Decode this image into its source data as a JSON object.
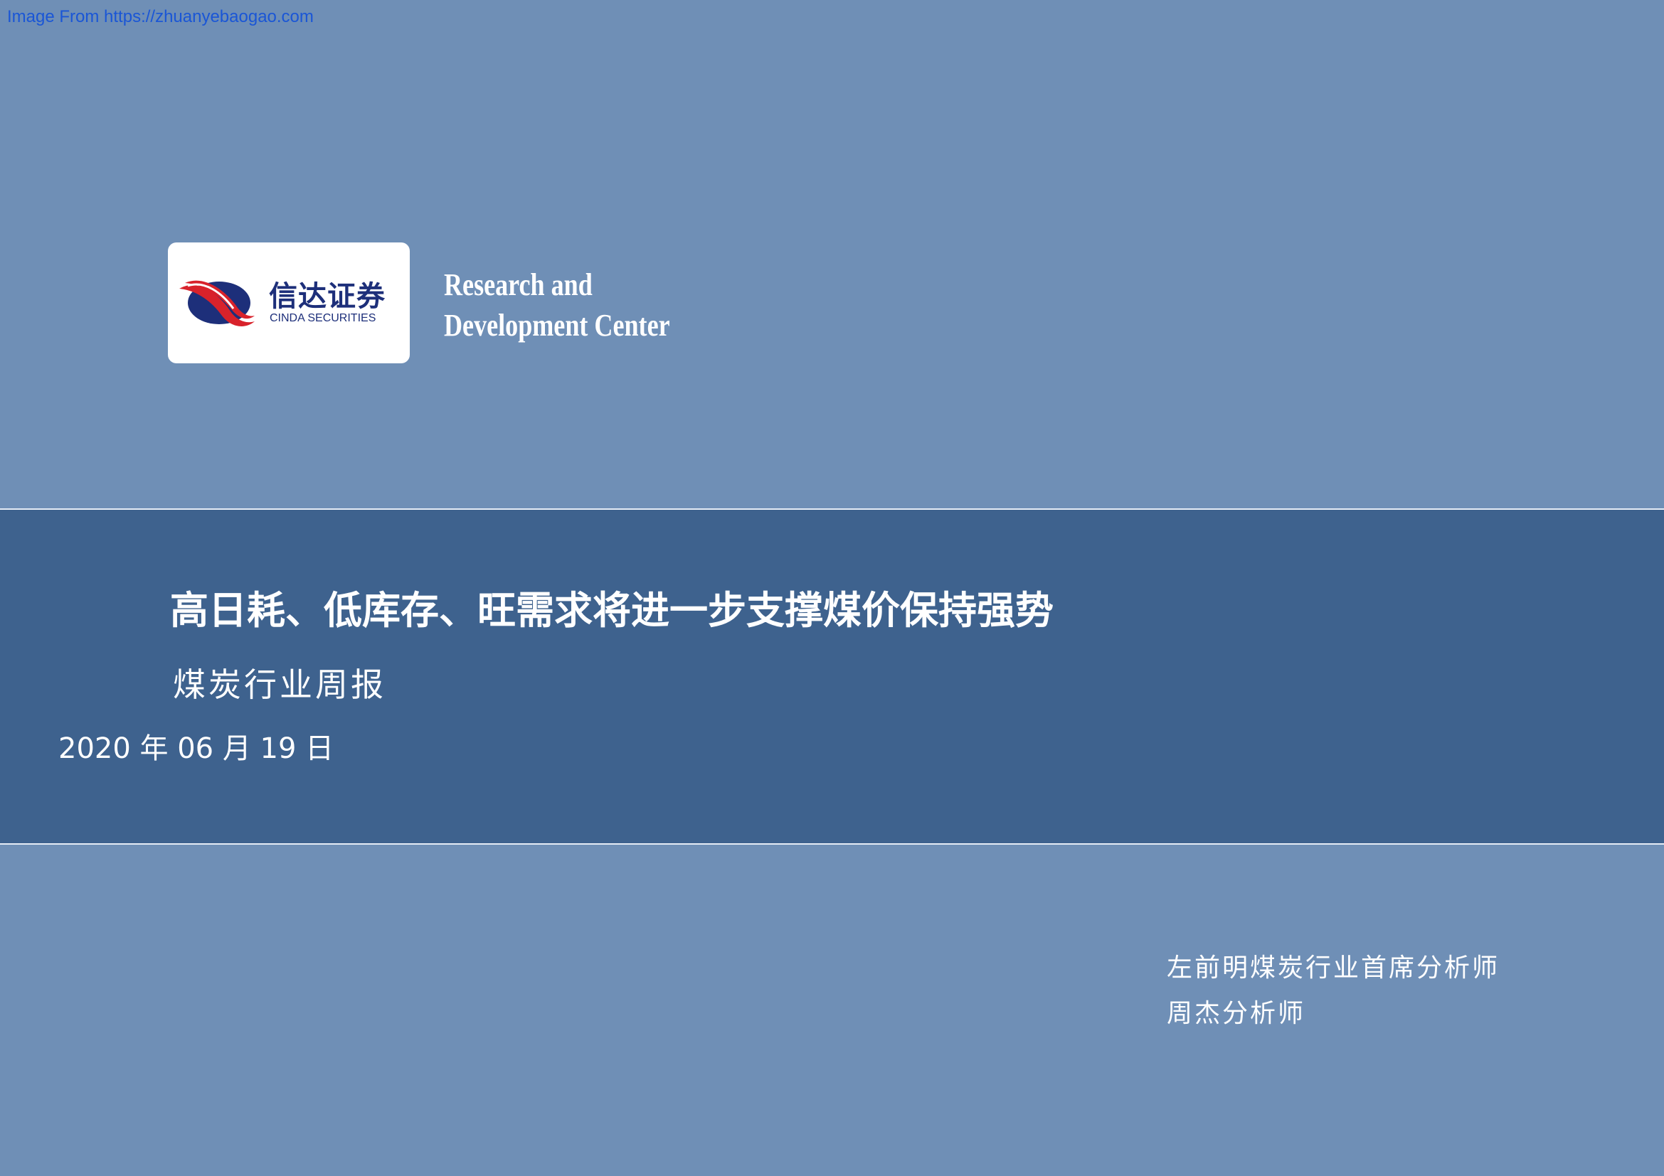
{
  "source_link": "Image From https://zhuanyebaogao.com",
  "logo": {
    "cn_name": "信达证券",
    "en_name": "CINDA SECURITIES"
  },
  "center": {
    "line1": "Research and",
    "line2": "Development Center"
  },
  "report": {
    "title": "高日耗、低库存、旺需求将进一步支撑煤价保持强势",
    "subtitle": "煤炭行业周报",
    "date": "2020 年 06 月 19 日"
  },
  "analysts": [
    "左前明煤炭行业首席分析师",
    "周杰分析师"
  ],
  "colors": {
    "background": "#6f8fb6",
    "band": "#3e628e",
    "logo_red": "#d8222b",
    "logo_navy": "#1d2f7a"
  }
}
